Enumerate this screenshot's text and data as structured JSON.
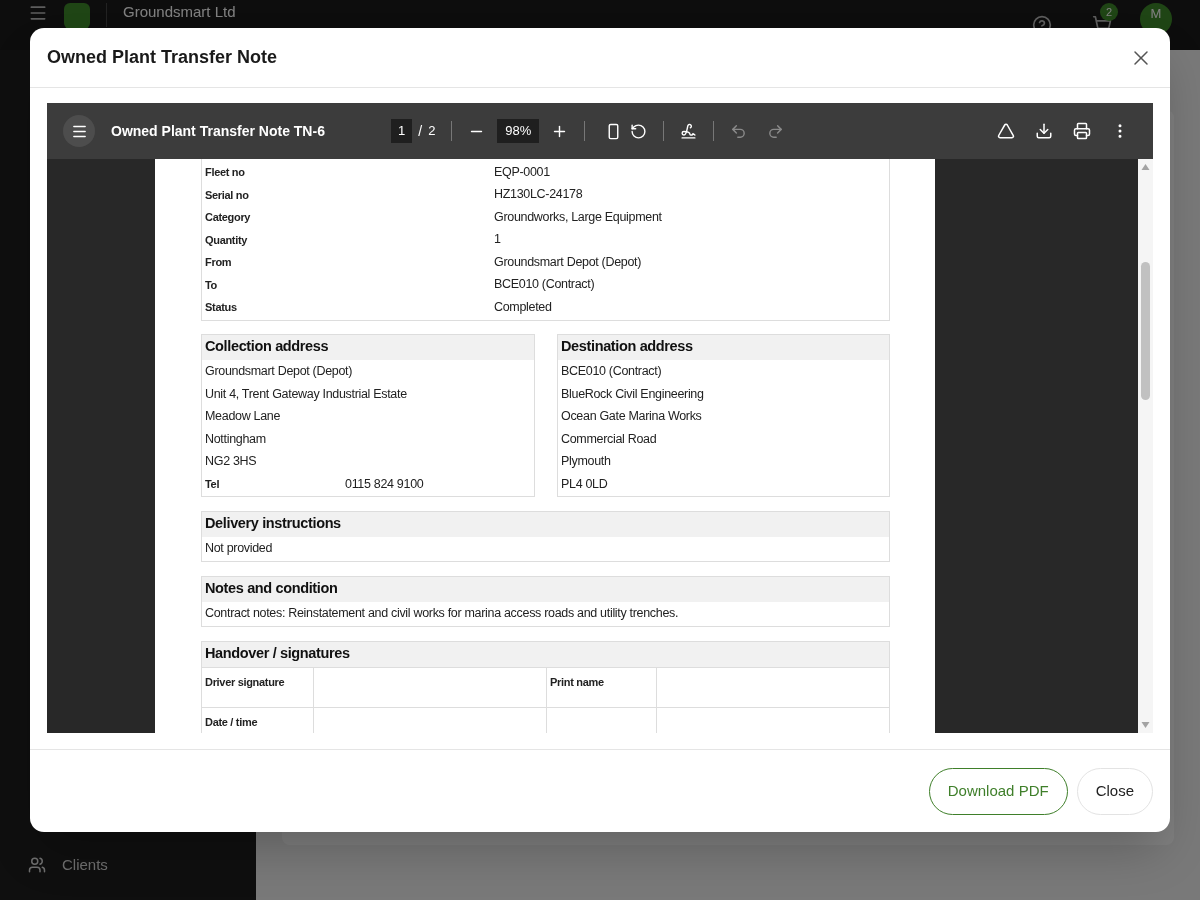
{
  "app": {
    "company": "Groundsmart Ltd",
    "cart_count": "2",
    "avatar": "M",
    "sidebar": {
      "items": [
        {
          "label": "Clients"
        }
      ]
    }
  },
  "dialog": {
    "title": "Owned Plant Transfer Note",
    "viewer": {
      "document_title": "Owned Plant Transfer Note TN-6",
      "page": "1",
      "separator": "/",
      "page_count": "2",
      "zoom": "98%",
      "tools": [
        {
          "kind": "fit",
          "disabled": false
        },
        {
          "kind": "rotate",
          "disabled": false
        },
        {
          "kind": "draw",
          "disabled": false
        },
        {
          "kind": "undo",
          "disabled": true
        },
        {
          "kind": "redo",
          "disabled": true
        }
      ],
      "actions": [
        {
          "kind": "drive"
        },
        {
          "kind": "download"
        },
        {
          "kind": "print"
        },
        {
          "kind": "more"
        }
      ]
    },
    "document": {
      "details": [
        {
          "label": "Fleet no",
          "value": "EQP-0001"
        },
        {
          "label": "Serial no",
          "value": "HZ130LC-24178"
        },
        {
          "label": "Category",
          "value": "Groundworks, Large Equipment"
        },
        {
          "label": "Quantity",
          "value": "1"
        },
        {
          "label": "From",
          "value": "Groundsmart Depot (Depot)"
        },
        {
          "label": "To",
          "value": "BCE010 (Contract)"
        },
        {
          "label": "Status",
          "value": "Completed"
        }
      ],
      "collection": {
        "heading": "Collection address",
        "lines": [
          "Groundsmart Depot (Depot)",
          "Unit 4, Trent Gateway Industrial Estate",
          "Meadow Lane",
          "Nottingham",
          "NG2 3HS"
        ],
        "tel": {
          "label": "Tel",
          "value": "0115 824 9100"
        }
      },
      "destination": {
        "heading": "Destination address",
        "lines": [
          "BCE010 (Contract)",
          "BlueRock Civil Engineering",
          "Ocean Gate Marina Works",
          "Commercial Road",
          "Plymouth",
          "PL4 0LD"
        ]
      },
      "delivery": {
        "heading": "Delivery instructions",
        "text": "Not provided"
      },
      "notes": {
        "heading": "Notes and condition",
        "text": "Contract notes: Reinstatement and civil works for marina access roads and utility trenches."
      },
      "handover": {
        "heading": "Handover / signatures",
        "rows": [
          {
            "label": "Driver signature",
            "label_2": "Print name"
          },
          {
            "label": "Date / time"
          }
        ]
      }
    },
    "buttons": [
      {
        "label": "Download PDF",
        "kind": "primary"
      },
      {
        "label": "Close",
        "kind": "secondary"
      }
    ]
  }
}
